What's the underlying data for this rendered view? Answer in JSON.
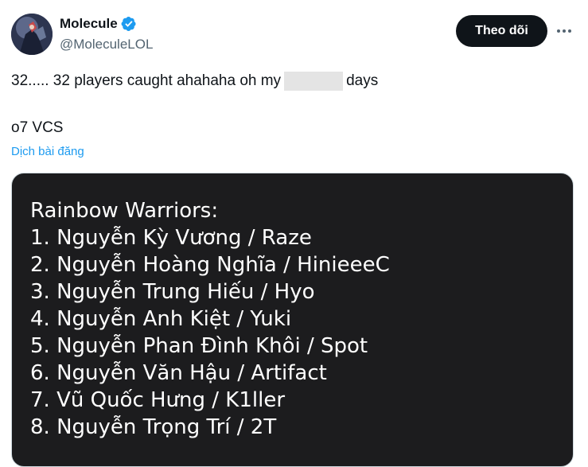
{
  "author": {
    "display_name": "Molecule",
    "handle": "@MoleculeLOL",
    "verified": true
  },
  "actions": {
    "follow_label": "Theo dõi"
  },
  "tweet": {
    "line1_prefix": "32..... 32 players caught ahahaha oh my",
    "line1_suffix": "days",
    "line2": "o7 VCS",
    "translate_label": "Dịch bài đăng"
  },
  "image_text": {
    "heading": "Rainbow Warriors:",
    "lines": [
      "1. Nguyễn Kỳ Vương / Raze",
      "2. Nguyễn Hoàng Nghĩa / HinieeeC",
      "3. Nguyễn Trung Hiếu / Hyo",
      "4. Nguyễn Anh Kiệt / Yuki",
      "5. Nguyễn Phan Đình Khôi / Spot",
      "6. Nguyễn Văn Hậu / Artifact",
      "7. Vũ Quốc Hưng / K1ller",
      "8. Nguyễn Trọng Trí / 2T"
    ]
  },
  "colors": {
    "accent": "#1d9bf0",
    "follow_bg": "#0f1419",
    "media_bg": "#1c1c1e"
  }
}
